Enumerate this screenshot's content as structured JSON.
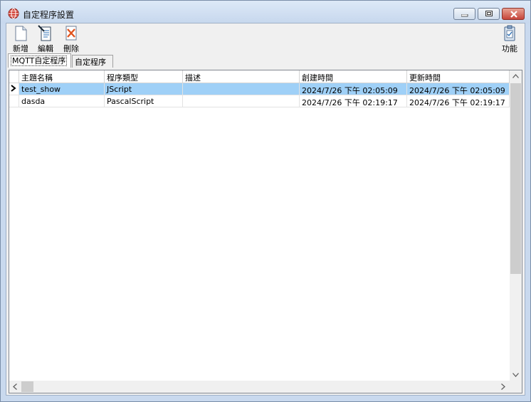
{
  "window": {
    "title": "自定程序設置"
  },
  "toolbar": {
    "new_label": "新增",
    "edit_label": "編輯",
    "delete_label": "刪除",
    "function_label": "功能"
  },
  "tabs": [
    {
      "label": "MQTT自定程序",
      "active": true
    },
    {
      "label": "自定程序",
      "active": false
    }
  ],
  "grid": {
    "columns": [
      "主題名稱",
      "程序類型",
      "描述",
      "創建時間",
      "更新時間"
    ],
    "rows": [
      {
        "name": "test_show",
        "type": "JScript",
        "desc": "",
        "created": "2024/7/26 下午 02:05:09",
        "updated": "2024/7/26 下午 02:05:09",
        "selected": true
      },
      {
        "name": "dasda",
        "type": "PascalScript",
        "desc": "",
        "created": "2024/7/26 下午 02:19:17",
        "updated": "2024/7/26 下午 02:19:17",
        "selected": false
      }
    ]
  },
  "colors": {
    "selection": "#9fd0f7",
    "close_button": "#c6453a"
  }
}
